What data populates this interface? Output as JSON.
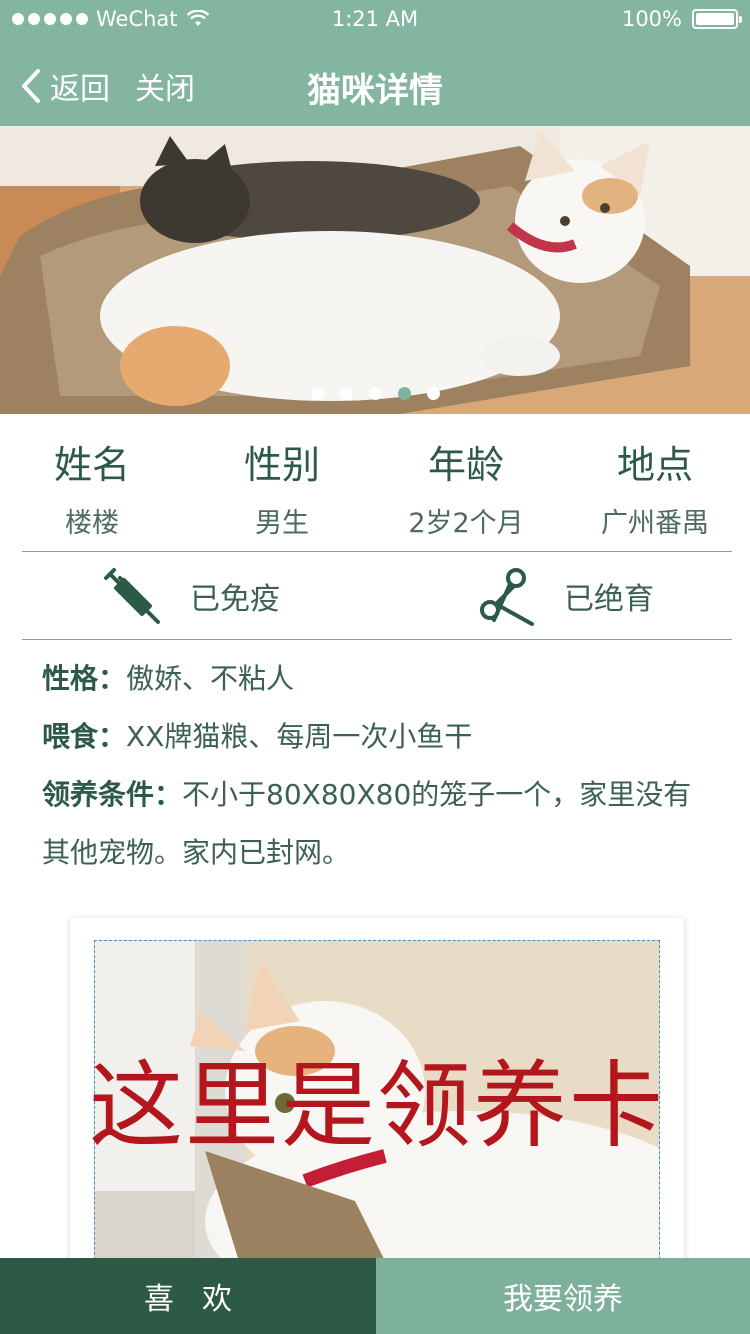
{
  "status_bar": {
    "carrier": "WeChat",
    "time": "1:21 AM",
    "battery": "100%"
  },
  "nav": {
    "back_label": "返回",
    "close_label": "关闭",
    "title": "猫咪详情"
  },
  "carousel": {
    "total": 5,
    "active_index": 3
  },
  "info": [
    {
      "label": "姓名",
      "value": "楼楼"
    },
    {
      "label": "性别",
      "value": "男生"
    },
    {
      "label": "年龄",
      "value": "2岁2个月"
    },
    {
      "label": "地点",
      "value": "广州番禺"
    }
  ],
  "health": {
    "vaccinated": "已免疫",
    "neutered": "已绝育"
  },
  "details": {
    "personality_key": "性格：",
    "personality_value": "傲娇、不粘人",
    "feeding_key": "喂食：",
    "feeding_value": "XX牌猫粮、每周一次小鱼干",
    "condition_key": "领养条件：",
    "condition_value": "不小于80X80X80的笼子一个，家里没有其他宠物。家内已封网。"
  },
  "card": {
    "overlay_text": "这里是领养卡"
  },
  "bottom_bar": {
    "like_label": "喜欢",
    "adopt_label": "我要领养"
  },
  "colors": {
    "header": "#84b5a0",
    "text_dark": "#2d5a47",
    "like_button": "#2d5a44",
    "adopt_button": "#7db19b",
    "overlay_text": "#b3161c"
  }
}
